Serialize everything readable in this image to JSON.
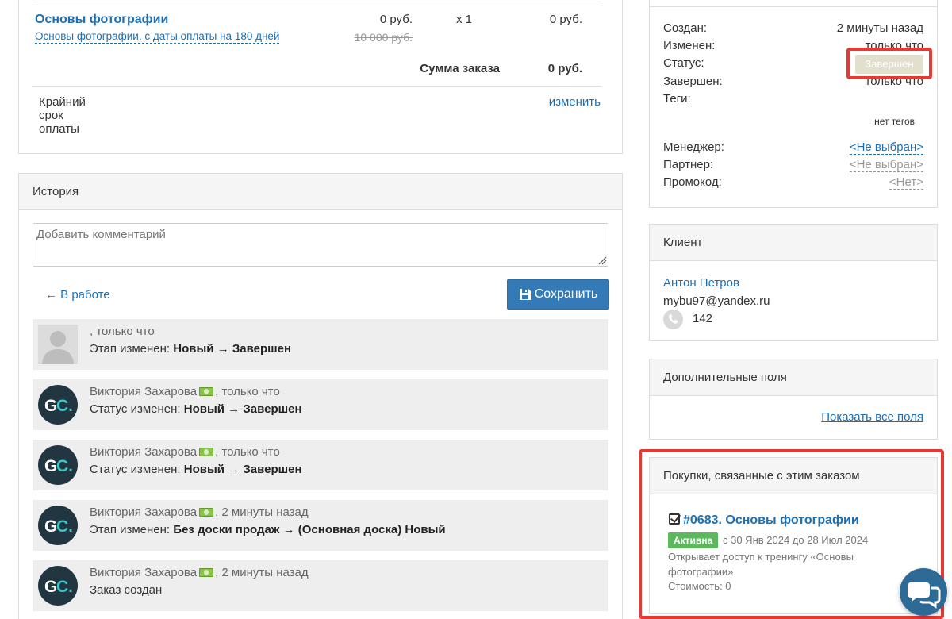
{
  "order": {
    "product_title": "Основы фотографии",
    "product_subtitle": "Основы фотографии, с даты оплаты на 180 дней",
    "price": "0 руб.",
    "old_price": "10 000 руб.",
    "quantity": "x 1",
    "line_total": "0 руб.",
    "sum_label": "Сумма заказа",
    "sum_value": "0 руб.",
    "deadline_label": "Крайний срок оплаты",
    "deadline_change": "изменить"
  },
  "history": {
    "title": "История",
    "comment_placeholder": "Добавить комментарий",
    "back_link": "← В работе",
    "save_label": "Сохранить",
    "items": [
      {
        "author": "",
        "time": ", только что",
        "action": "Этап изменен:",
        "change": "Новый → Завершен",
        "avatar": "placeholder",
        "money": false
      },
      {
        "author": "Виктория Захарова",
        "time": ", только что",
        "action": "Статус изменен:",
        "change": "Новый → Завершен",
        "avatar": "gc",
        "money": true
      },
      {
        "author": "Виктория Захарова",
        "time": ", только что",
        "action": "Статус изменен:",
        "change": "Новый → Завершен",
        "avatar": "gc",
        "money": true
      },
      {
        "author": "Виктория Захарова",
        "time": ", 2 минуты назад",
        "action": "Этап изменен:",
        "change": "Без доски продаж → (Основная доска) Новый",
        "avatar": "gc",
        "money": true
      },
      {
        "author": "Виктория Захарова",
        "time": ", 2 минуты назад",
        "action": "Заказ создан",
        "change": "",
        "avatar": "gc",
        "money": true
      }
    ]
  },
  "status_panel": {
    "created_label": "Создан:",
    "created_value": "2 минуты назад",
    "changed_label": "Изменен:",
    "changed_value": "только что",
    "status_label": "Статус:",
    "status_value": "Завершен",
    "completed_label": "Завершен:",
    "completed_value": "только что",
    "tags_label": "Теги:",
    "tags_value": "нет тегов",
    "manager_label": "Менеджер:",
    "manager_value": "<Не выбран>",
    "partner_label": "Партнер:",
    "partner_value": "<Не выбран>",
    "promo_label": "Промокод:",
    "promo_value": "<Нет>"
  },
  "client": {
    "title": "Клиент",
    "name": "Антон Петров",
    "email": "mybu97@yandex.ru",
    "phone": "142"
  },
  "extra_fields": {
    "title": "Дополнительные поля",
    "show_all": "Показать все поля"
  },
  "purchases": {
    "title": "Покупки, связанные с этим заказом",
    "item_title": "#0683. Основы фотографии",
    "badge": "Активна",
    "dates": "с 30 Янв 2024 до 28 Июл 2024",
    "description": "Открывает доступ к тренингу «Основы фотографии»",
    "cost": "Стоимость: 0"
  },
  "colors": {
    "link": "#1d6fb3",
    "primary_button": "#337ab7",
    "highlight": "#e53935",
    "active_badge": "#5cb85c",
    "status_badge": "#e2dfcc"
  },
  "icons": {
    "save": "floppy-icon",
    "phone": "phone-icon",
    "check": "check-square-icon",
    "chat": "chat-icon",
    "money": "banknote-icon"
  }
}
